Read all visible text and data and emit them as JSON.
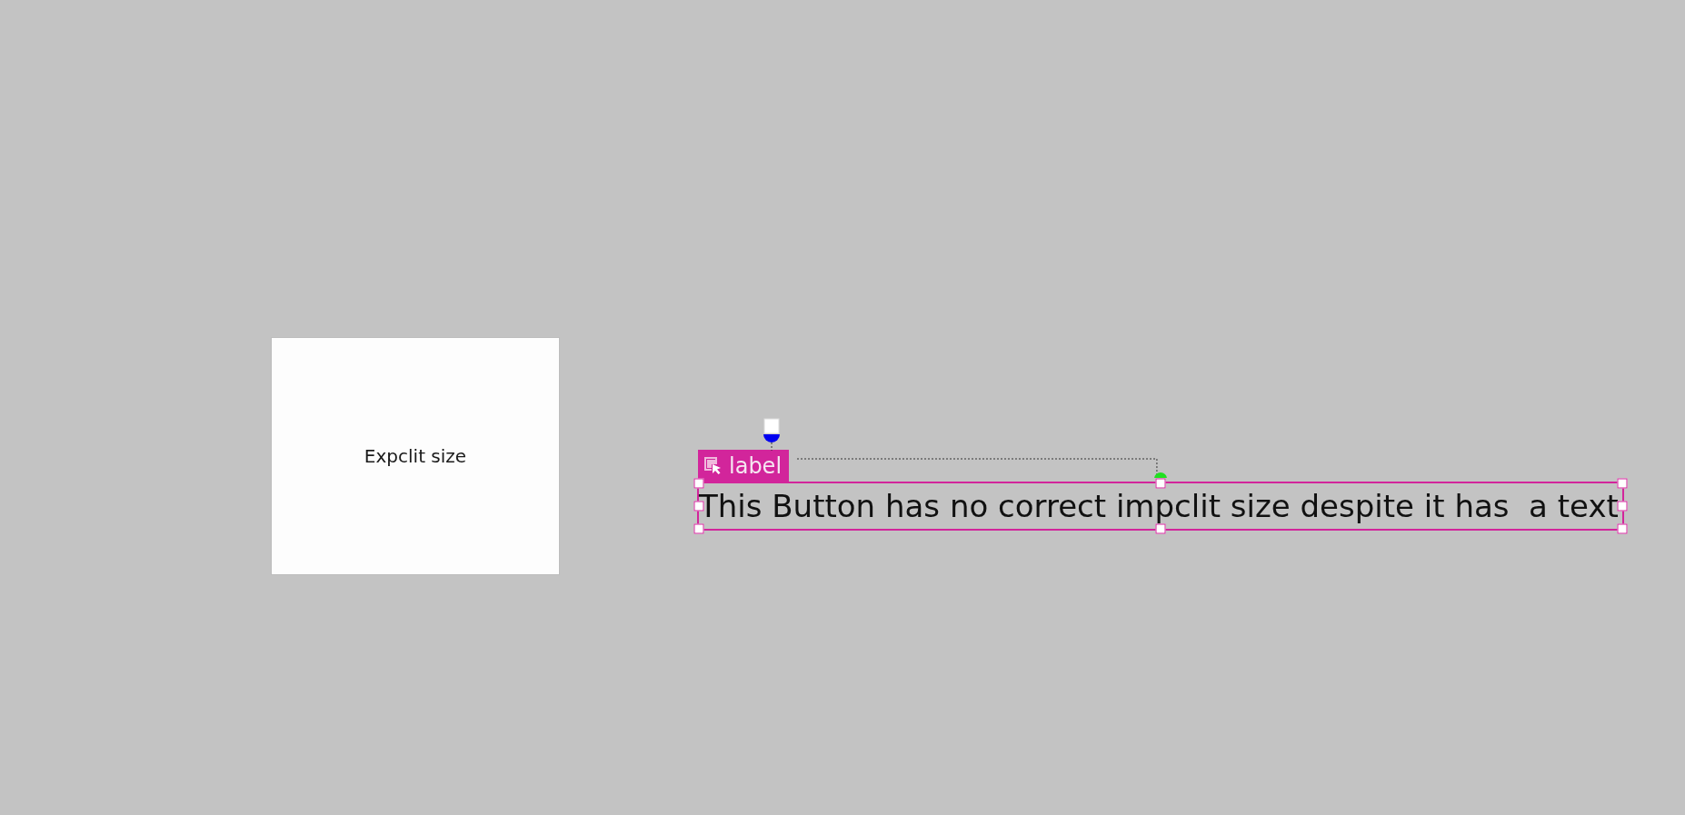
{
  "canvas": {
    "button": {
      "label": "Expclit size"
    },
    "selected_element": {
      "type_tag": "label",
      "text": "This Button has no correct impclit size despite it has  a text",
      "selected": true
    }
  }
}
